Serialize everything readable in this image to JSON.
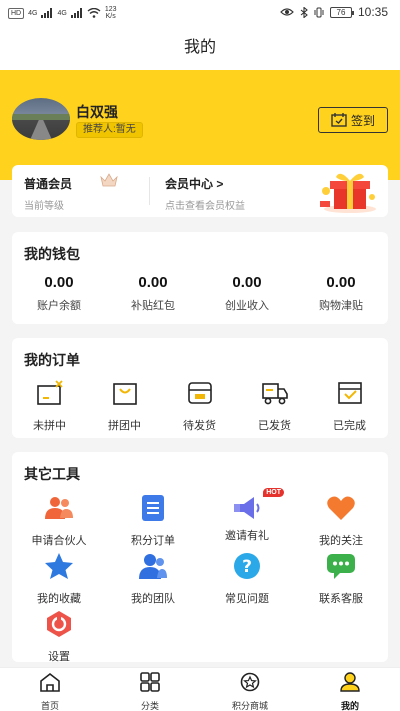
{
  "status_bar": {
    "chip_hd": "HD",
    "signal_1": "4G",
    "signal_2": "4G",
    "net_speed_value": "123",
    "net_speed_unit": "K/s",
    "battery": "76",
    "time": "10:35"
  },
  "header": {
    "title": "我的"
  },
  "profile": {
    "username": "白双强",
    "referrer": "推荐人:暂无",
    "signin_label": "签到"
  },
  "member": {
    "level_title": "普通会员",
    "level_sub": "当前等级",
    "center_title": "会员中心 >",
    "center_sub": "点击查看会员权益"
  },
  "wallet": {
    "title": "我的钱包",
    "items": [
      {
        "value": "0.00",
        "label": "账户余额"
      },
      {
        "value": "0.00",
        "label": "补贴红包"
      },
      {
        "value": "0.00",
        "label": "创业收入"
      },
      {
        "value": "0.00",
        "label": "购物津贴"
      }
    ]
  },
  "orders": {
    "title": "我的订单",
    "items": [
      {
        "label": "未拼中",
        "icon": "box-x-icon"
      },
      {
        "label": "拼团中",
        "icon": "shopping-bag-icon"
      },
      {
        "label": "待发货",
        "icon": "package-icon"
      },
      {
        "label": "已发货",
        "icon": "truck-icon"
      },
      {
        "label": "已完成",
        "icon": "box-check-icon"
      }
    ]
  },
  "tools": {
    "title": "其它工具",
    "hot_badge": "HOT",
    "items": [
      {
        "label": "申请合伙人",
        "icon": "partner-icon",
        "color": "#f0663a"
      },
      {
        "label": "积分订单",
        "icon": "list-icon",
        "color": "#3f7be8"
      },
      {
        "label": "邀请有礼",
        "icon": "megaphone-icon",
        "color": "#6a6ee8"
      },
      {
        "label": "我的关注",
        "icon": "heart-icon",
        "color": "#f47a2f"
      },
      {
        "label": "我的收藏",
        "icon": "star-icon",
        "color": "#2d79e0"
      },
      {
        "label": "我的团队",
        "icon": "team-icon",
        "color": "#2f6fe0"
      },
      {
        "label": "常见问题",
        "icon": "question-icon",
        "color": "#2aa8e8"
      },
      {
        "label": "联系客服",
        "icon": "chat-icon",
        "color": "#3cb04a"
      },
      {
        "label": "设置",
        "icon": "settings-icon",
        "color": "#ee5349"
      }
    ]
  },
  "tabbar": {
    "items": [
      {
        "label": "首页",
        "icon": "home-icon"
      },
      {
        "label": "分类",
        "icon": "grid-icon"
      },
      {
        "label": "积分商城",
        "icon": "points-star-icon"
      },
      {
        "label": "我的",
        "icon": "profile-icon"
      }
    ],
    "active_index": 3,
    "accent": "#ffd21e"
  }
}
